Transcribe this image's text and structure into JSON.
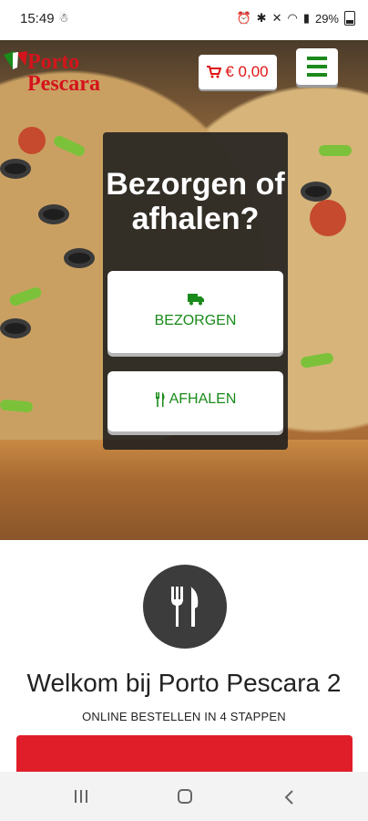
{
  "status_bar": {
    "time": "15:49",
    "battery": "29%"
  },
  "brand": {
    "logo_line1": "Porto",
    "logo_line2": "Pescara",
    "accent_red": "#e01414",
    "accent_green": "#1a8a1a"
  },
  "header": {
    "cart_total": "€ 0,00",
    "cart_icon": "cart-icon",
    "menu_icon": "hamburger-icon"
  },
  "choice": {
    "title": "Bezorgen of afhalen?",
    "delivery_label": "BEZORGEN",
    "delivery_icon": "truck-icon",
    "pickup_label": "AFHALEN",
    "pickup_icon": "cutlery-icon"
  },
  "welcome": {
    "icon": "fork-knife-icon",
    "title": "Welkom bij Porto Pescara 2",
    "subtitle": "ONLINE BESTELLEN IN 4 STAPPEN"
  },
  "nav": {
    "recent_icon": "recent-apps-icon",
    "home_icon": "home-icon",
    "back_icon": "back-icon"
  }
}
